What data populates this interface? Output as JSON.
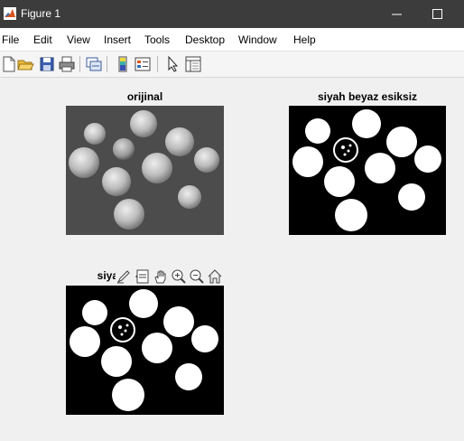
{
  "window": {
    "title": "Figure 1"
  },
  "menu": [
    "File",
    "Edit",
    "View",
    "Insert",
    "Tools",
    "Desktop",
    "Window",
    "Help"
  ],
  "toolbar": {
    "icons": [
      "new-figure-icon",
      "open-file-icon",
      "save-icon",
      "print-icon",
      "link-plot-icon",
      "colorbar-icon",
      "legend-icon",
      "edit-plot-icon",
      "property-inspector-icon"
    ]
  },
  "axes": [
    {
      "title": "orijinal"
    },
    {
      "title": "siyah beyaz esiksiz"
    },
    {
      "title": "siya"
    }
  ],
  "axes_toolbar": {
    "icons": [
      "brush-icon",
      "data-tips-icon",
      "pan-icon",
      "zoom-in-icon",
      "zoom-out-icon",
      "home-icon"
    ]
  }
}
